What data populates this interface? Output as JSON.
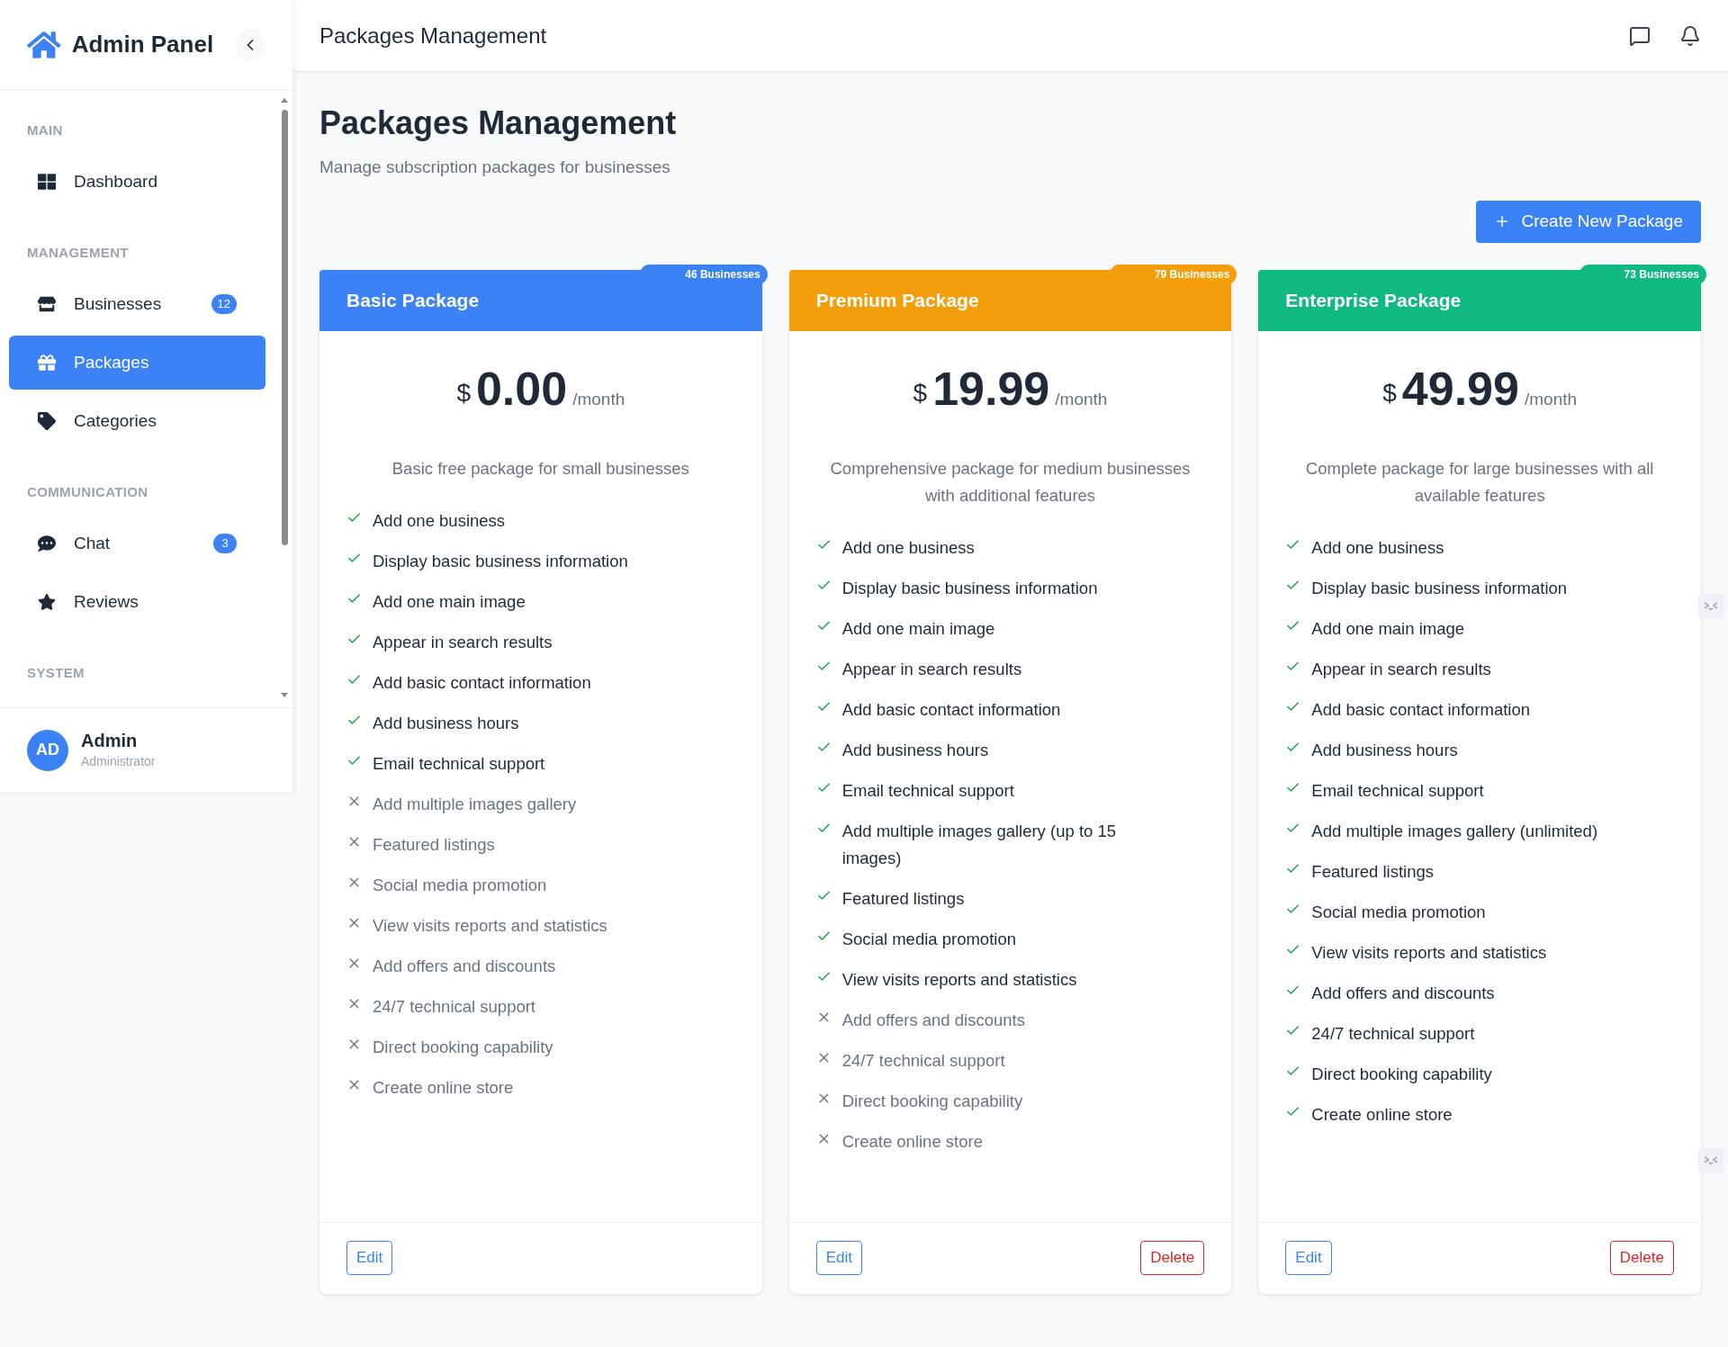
{
  "sidebar": {
    "brand": "Admin Panel",
    "sections": [
      {
        "title": "MAIN",
        "items": [
          {
            "label": "Dashboard",
            "kind": "grid",
            "selected": false
          }
        ]
      },
      {
        "title": "MANAGEMENT",
        "items": [
          {
            "label": "Businesses",
            "kind": "store",
            "badge": "12",
            "selected": false
          },
          {
            "label": "Packages",
            "kind": "gift",
            "selected": true
          },
          {
            "label": "Categories",
            "kind": "tag",
            "selected": false
          }
        ]
      },
      {
        "title": "COMMUNICATION",
        "items": [
          {
            "label": "Chat",
            "kind": "chat",
            "badge": "3",
            "selected": false
          },
          {
            "label": "Reviews",
            "kind": "star",
            "selected": false
          }
        ]
      },
      {
        "title": "SYSTEM"
      }
    ],
    "user": {
      "initials": "AD",
      "name": "Admin",
      "role": "Administrator"
    }
  },
  "header": {
    "title": "Packages Management"
  },
  "page": {
    "title": "Packages Management",
    "subtitle": "Manage subscription packages for businesses",
    "create_button": "Create New Package"
  },
  "packages": [
    {
      "name": "Basic Package",
      "badge": "46 Businesses",
      "color": "#3b82f6",
      "currency": "$",
      "amount": "0.00",
      "period": "/month",
      "description": "Basic free package for small businesses",
      "features": [
        {
          "text": "Add one business",
          "included": true
        },
        {
          "text": "Display basic business information",
          "included": true
        },
        {
          "text": "Add one main image",
          "included": true
        },
        {
          "text": "Appear in search results",
          "included": true
        },
        {
          "text": "Add basic contact information",
          "included": true
        },
        {
          "text": "Add business hours",
          "included": true
        },
        {
          "text": "Email technical support",
          "included": true
        },
        {
          "text": "Add multiple images gallery",
          "included": false
        },
        {
          "text": "Featured listings",
          "included": false
        },
        {
          "text": "Social media promotion",
          "included": false
        },
        {
          "text": "View visits reports and statistics",
          "included": false
        },
        {
          "text": "Add offers and discounts",
          "included": false
        },
        {
          "text": "24/7 technical support",
          "included": false
        },
        {
          "text": "Direct booking capability",
          "included": false
        },
        {
          "text": "Create online store",
          "included": false
        }
      ],
      "actions": [
        {
          "label": "Edit",
          "kind": "edit"
        }
      ]
    },
    {
      "name": "Premium Package",
      "badge": "79 Businesses",
      "color": "#f59e0b",
      "currency": "$",
      "amount": "19.99",
      "period": "/month",
      "description": "Comprehensive package for medium businesses with additional features",
      "features": [
        {
          "text": "Add one business",
          "included": true
        },
        {
          "text": "Display basic business information",
          "included": true
        },
        {
          "text": "Add one main image",
          "included": true
        },
        {
          "text": "Appear in search results",
          "included": true
        },
        {
          "text": "Add basic contact information",
          "included": true
        },
        {
          "text": "Add business hours",
          "included": true
        },
        {
          "text": "Email technical support",
          "included": true
        },
        {
          "text": "Add multiple images gallery (up to 15 images)",
          "included": true
        },
        {
          "text": "Featured listings",
          "included": true
        },
        {
          "text": "Social media promotion",
          "included": true
        },
        {
          "text": "View visits reports and statistics",
          "included": true
        },
        {
          "text": "Add offers and discounts",
          "included": false
        },
        {
          "text": "24/7 technical support",
          "included": false
        },
        {
          "text": "Direct booking capability",
          "included": false
        },
        {
          "text": "Create online store",
          "included": false
        }
      ],
      "actions": [
        {
          "label": "Edit",
          "kind": "edit"
        },
        {
          "label": "Delete",
          "kind": "delete"
        }
      ]
    },
    {
      "name": "Enterprise Package",
      "badge": "73 Businesses",
      "color": "#10b981",
      "currency": "$",
      "amount": "49.99",
      "period": "/month",
      "description": "Complete package for large businesses with all available features",
      "features": [
        {
          "text": "Add one business",
          "included": true
        },
        {
          "text": "Display basic business information",
          "included": true
        },
        {
          "text": "Add one main image",
          "included": true
        },
        {
          "text": "Appear in search results",
          "included": true
        },
        {
          "text": "Add basic contact information",
          "included": true
        },
        {
          "text": "Add business hours",
          "included": true
        },
        {
          "text": "Email technical support",
          "included": true
        },
        {
          "text": "Add multiple images gallery (unlimited)",
          "included": true
        },
        {
          "text": "Featured listings",
          "included": true
        },
        {
          "text": "Social media promotion",
          "included": true
        },
        {
          "text": "View visits reports and statistics",
          "included": true
        },
        {
          "text": "Add offers and discounts",
          "included": true
        },
        {
          "text": "24/7 technical support",
          "included": true
        },
        {
          "text": "Direct booking capability",
          "included": true
        },
        {
          "text": "Create online store",
          "included": true
        }
      ],
      "actions": [
        {
          "label": "Edit",
          "kind": "edit"
        },
        {
          "label": "Delete",
          "kind": "delete"
        }
      ]
    }
  ]
}
